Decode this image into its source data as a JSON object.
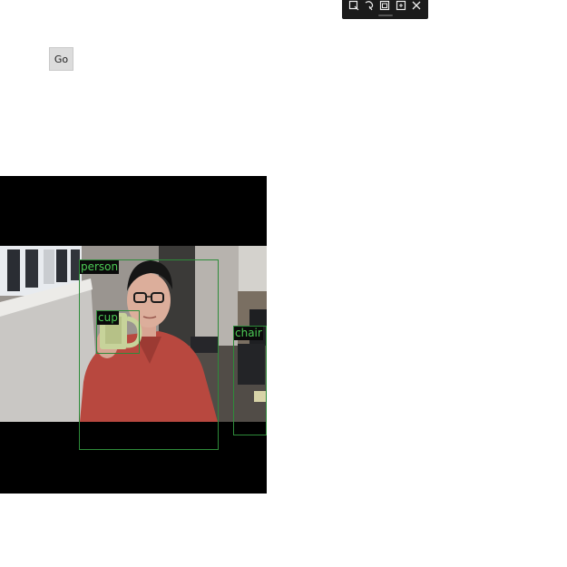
{
  "toolbar": {
    "tools": [
      {
        "icon": "rect-snip-icon"
      },
      {
        "icon": "freeform-snip-icon"
      },
      {
        "icon": "window-snip-icon"
      },
      {
        "icon": "fullscreen-snip-icon"
      },
      {
        "icon": "close-icon"
      }
    ]
  },
  "go_button": {
    "label": "Go"
  },
  "detections": [
    {
      "label": "person"
    },
    {
      "label": "cup"
    },
    {
      "label": "chair"
    }
  ],
  "colors": {
    "bbox": "#2e8b3a",
    "label_text": "#4ccb55",
    "label_bg": "#0a0a0a",
    "toolbar_bg": "#1b1b1b"
  }
}
